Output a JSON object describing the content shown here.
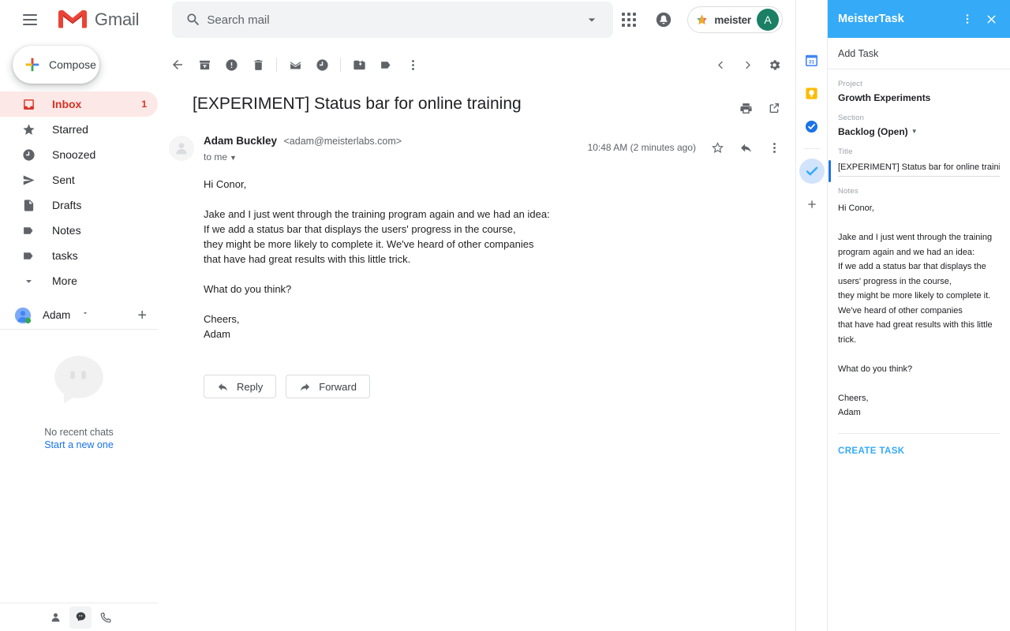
{
  "topbar": {
    "menu_icon": "hamburger-icon",
    "brand": "Gmail",
    "search": {
      "icon": "search-icon",
      "placeholder": "Search mail",
      "value": "",
      "options_icon": "chevron-down-icon"
    },
    "apps_icon": "apps-grid-icon",
    "notifications_icon": "notifications-bell-icon",
    "meister_chip_label": "meister",
    "account_initial": "A"
  },
  "sidebar": {
    "compose_label": "Compose",
    "compose_icon": "plus-icon",
    "items": [
      {
        "label": "Inbox",
        "icon": "inbox-icon",
        "count": "1",
        "active": true
      },
      {
        "label": "Starred",
        "icon": "star-icon",
        "count": "",
        "active": false
      },
      {
        "label": "Snoozed",
        "icon": "clock-icon",
        "count": "",
        "active": false
      },
      {
        "label": "Sent",
        "icon": "send-icon",
        "count": "",
        "active": false
      },
      {
        "label": "Drafts",
        "icon": "draft-icon",
        "count": "",
        "active": false
      },
      {
        "label": "Notes",
        "icon": "label-icon",
        "count": "",
        "active": false
      },
      {
        "label": "tasks",
        "icon": "label-icon",
        "count": "",
        "active": false
      },
      {
        "label": "More",
        "icon": "chevron-down-icon",
        "count": "",
        "active": false
      }
    ],
    "account": {
      "name": "Adam",
      "caret_icon": "chevron-down-icon",
      "add_icon": "plus-icon"
    },
    "chat": {
      "empty_icon": "chat-bubble-icon",
      "empty_text": "No recent chats",
      "start_link": "Start a new one"
    },
    "footer_icons": [
      "person-icon",
      "chat-bubble-icon",
      "phone-icon"
    ]
  },
  "toolbar": {
    "back_icon": "arrow-back-icon",
    "archive_icon": "archive-icon",
    "report_spam_icon": "report-spam-icon",
    "delete_icon": "trash-icon",
    "mark_unread_icon": "mark-unread-icon",
    "snooze_icon": "clock-icon",
    "move_to_icon": "move-to-folder-icon",
    "labels_icon": "label-icon",
    "more_icon": "more-vert-icon",
    "prev_icon": "chevron-left-icon",
    "next_icon": "chevron-right-icon",
    "settings_icon": "gear-icon"
  },
  "email": {
    "subject": "[EXPERIMENT] Status bar for online training",
    "print_icon": "print-icon",
    "popout_icon": "open-in-new-icon",
    "avatar_icon": "person-avatar-icon",
    "sender_name": "Adam Buckley",
    "sender_email": "<adam@meisterlabs.com>",
    "recipients": "to me",
    "timestamp": "10:48 AM (2 minutes ago)",
    "star_icon": "star-outline-icon",
    "reply_arrow_icon": "reply-icon",
    "more_icon": "more-vert-icon",
    "body": "Hi Conor,\n\nJake and I just went through the training program again and we had an idea:\nIf we add a status bar that displays the users' progress in the course,\nthey might be more likely to complete it. We've heard of other companies\nthat have had great results with this little trick.\n\nWhat do you think?\n\nCheers,\nAdam",
    "reply_label": "Reply",
    "reply_icon": "reply-icon",
    "forward_label": "Forward",
    "forward_icon": "forward-arrow-icon"
  },
  "rail": {
    "items": [
      {
        "name": "google-calendar-icon",
        "selected": false
      },
      {
        "name": "google-keep-icon",
        "selected": false
      },
      {
        "name": "google-tasks-icon",
        "selected": false
      },
      {
        "name": "meistertask-icon",
        "selected": true
      }
    ],
    "add_icon": "plus-icon"
  },
  "meistertask": {
    "title": "MeisterTask",
    "more_icon": "more-vert-icon",
    "close_icon": "close-icon",
    "add_task_label": "Add Task",
    "project_label": "Project",
    "project_value": "Growth Experiments",
    "section_label": "Section",
    "section_value": "Backlog (Open)",
    "section_caret_icon": "chevron-down-icon",
    "title_label": "Title",
    "title_value": "[EXPERIMENT] Status bar for online training",
    "title_placeholder": "Title",
    "notes_label": "Notes",
    "notes_value": "Hi Conor,\n\nJake and I just went through the training\nprogram again and we had an idea:\nIf we add a status bar that displays the\nusers' progress in the course,\nthey might be more likely to complete it.\nWe've heard of other companies\nthat have had great results with this little\ntrick.\n\nWhat do you think?\n\nCheers,\nAdam",
    "create_task_label": "CREATE TASK"
  },
  "colors": {
    "meistertask_blue": "#35aaf7",
    "gmail_red": "#d93025",
    "inbox_highlight": "#fce8e6",
    "link_blue": "#1a73e8"
  }
}
